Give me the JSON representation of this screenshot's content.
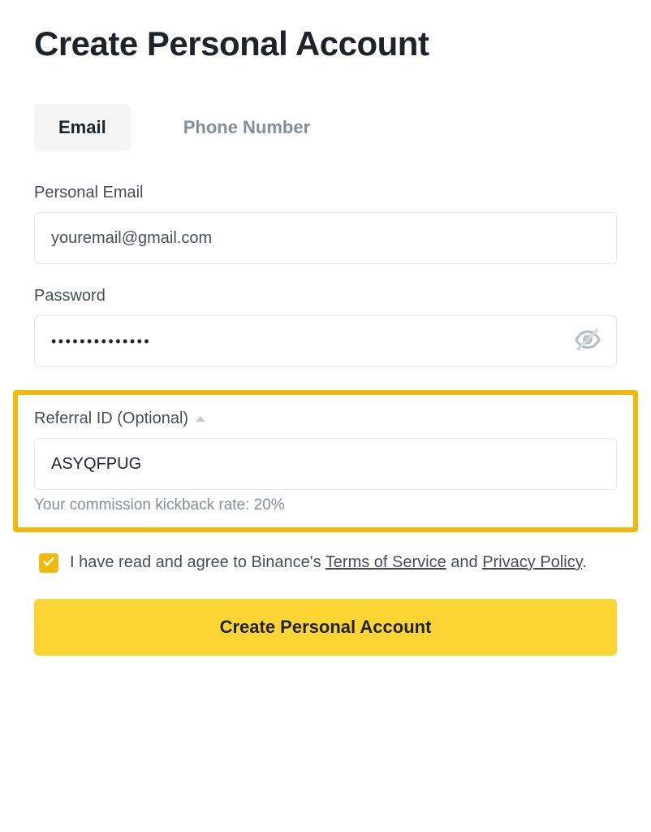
{
  "title": "Create Personal Account",
  "tabs": {
    "email": "Email",
    "phone": "Phone Number"
  },
  "email_field": {
    "label": "Personal Email",
    "value": "youremail@gmail.com"
  },
  "password_field": {
    "label": "Password",
    "value": "••••••••••••••"
  },
  "referral_field": {
    "label": "Referral ID (Optional)",
    "value": "ASYQFPUG",
    "kickback_text": "Your commission kickback rate: 20%"
  },
  "agree": {
    "part1": "I have read and agree to Binance's ",
    "tos": "Terms of Service",
    "part2": " and ",
    "privacy": "Privacy Policy",
    "part3": "."
  },
  "submit_label": "Create Personal Account"
}
